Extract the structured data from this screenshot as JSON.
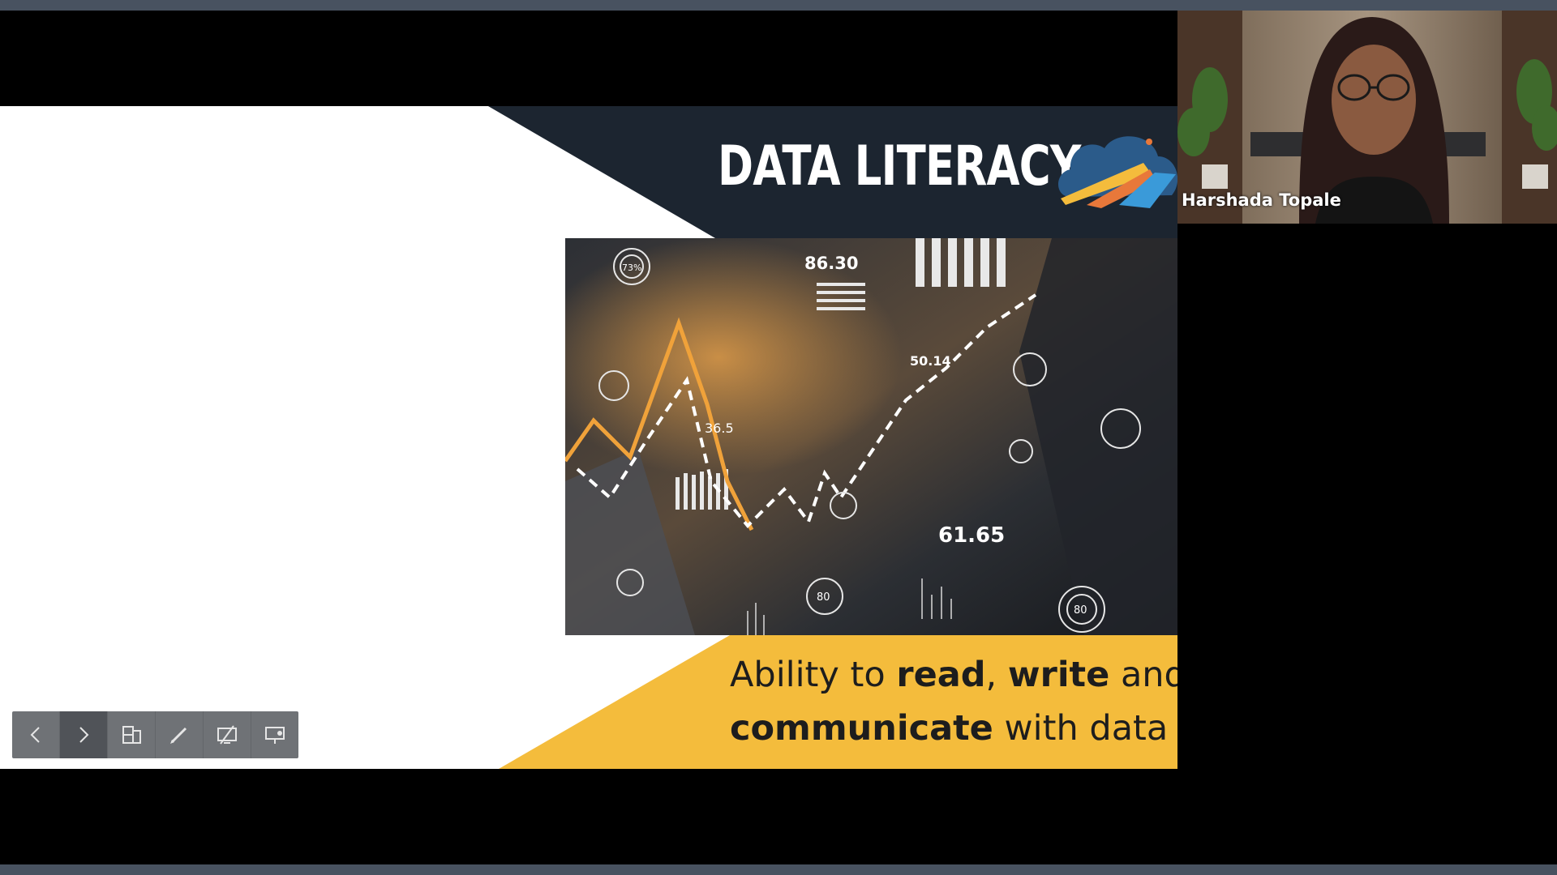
{
  "slide": {
    "title": "DATA LITERACY",
    "hero_numbers": [
      "86.30",
      "50.14",
      "61.65",
      "73%",
      "36.5",
      "80",
      "80"
    ],
    "tagline": {
      "line1_pre": "Ability to ",
      "line1_bold1": "read",
      "line1_sep": ", ",
      "line1_bold2": "write",
      "line1_post": " and",
      "line2_bold": "communicate",
      "line2_post": " with data"
    }
  },
  "toolbar": {
    "items": [
      {
        "name": "prev-slide-button",
        "icon": "chevron-left-icon"
      },
      {
        "name": "next-slide-button",
        "icon": "chevron-right-icon"
      },
      {
        "name": "slides-overview-button",
        "icon": "slides-icon"
      },
      {
        "name": "pen-tool-button",
        "icon": "pen-icon"
      },
      {
        "name": "hide-slide-button",
        "icon": "screen-slash-icon"
      },
      {
        "name": "presenter-view-button",
        "icon": "presenter-icon"
      }
    ]
  },
  "video": {
    "participant_name": "Harshada Topale"
  },
  "colors": {
    "frame": "#485260",
    "slide_dark": "#1c2530",
    "accent_yellow": "#f4bc3c",
    "chart_orange": "#f0a23a"
  }
}
